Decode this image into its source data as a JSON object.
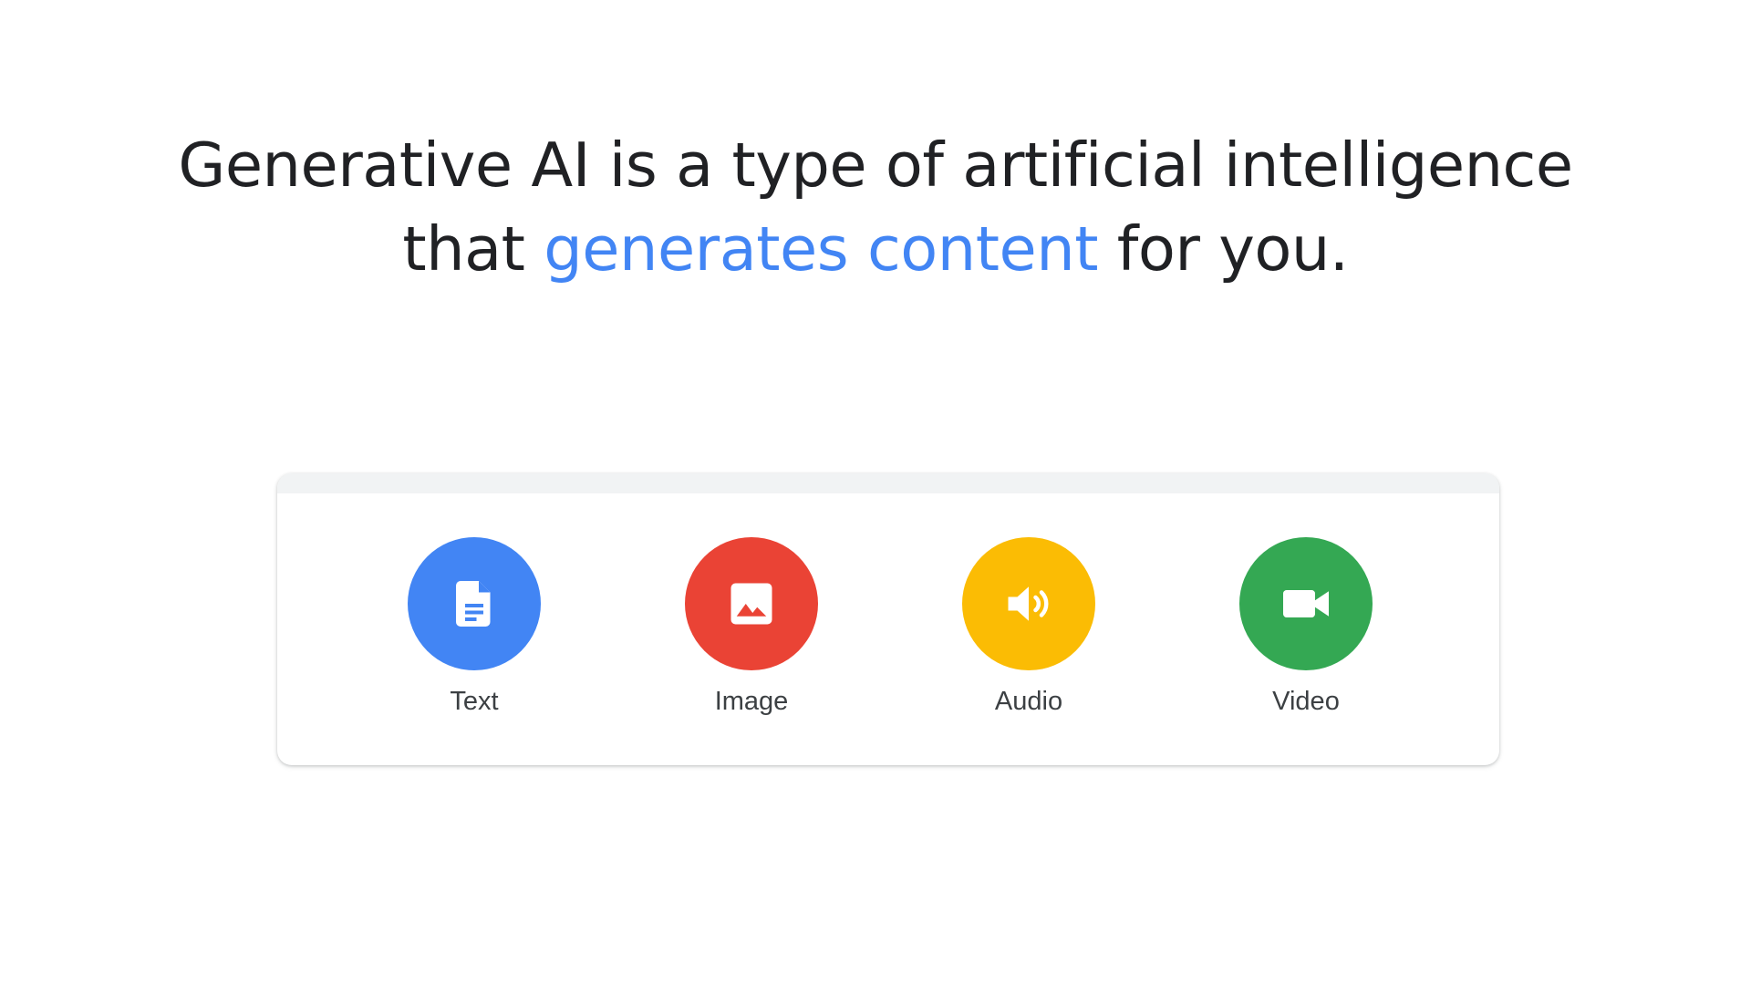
{
  "headline": {
    "line1": "Generative AI is a type of artificial intelligence",
    "line2_before": "that ",
    "line2_accent": "generates content",
    "line2_after": " for you."
  },
  "colors": {
    "accent": "#4285f4",
    "text_icon": "#4285f4",
    "image_icon": "#ea4335",
    "audio_icon": "#fbbc04",
    "video_icon": "#34a853"
  },
  "content_types": [
    {
      "label": "Text",
      "icon": "document-icon"
    },
    {
      "label": "Image",
      "icon": "image-icon"
    },
    {
      "label": "Audio",
      "icon": "speaker-icon"
    },
    {
      "label": "Video",
      "icon": "video-camera-icon"
    }
  ]
}
